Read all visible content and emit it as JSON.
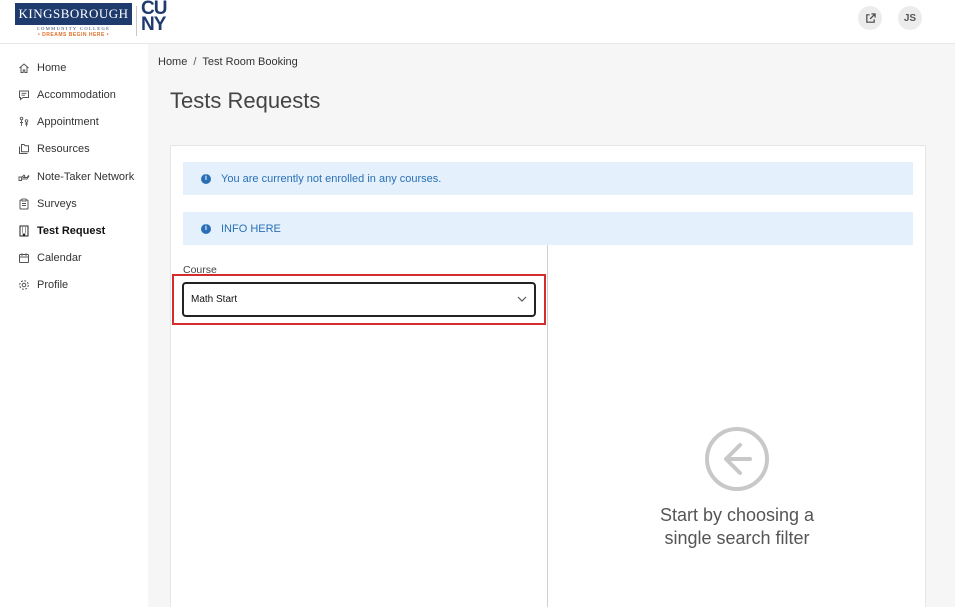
{
  "header": {
    "logo_line1": "KINGSBOROUGH",
    "logo_line2": "COMMUNITY COLLEGE",
    "logo_tagline": "• DREAMS BEGIN HERE •",
    "cuny_top": "CU",
    "cuny_bottom": "NY",
    "external_icon": "external-link-icon",
    "avatar_initials": "JS"
  },
  "sidebar": {
    "items": [
      {
        "label": "Home",
        "icon": "home-icon"
      },
      {
        "label": "Accommodation",
        "icon": "chat-icon"
      },
      {
        "label": "Appointment",
        "icon": "people-icon"
      },
      {
        "label": "Resources",
        "icon": "folders-icon"
      },
      {
        "label": "Note-Taker Network",
        "icon": "hand-icon"
      },
      {
        "label": "Surveys",
        "icon": "clipboard-icon"
      },
      {
        "label": "Test Request",
        "icon": "building-icon",
        "active": true
      },
      {
        "label": "Calendar",
        "icon": "calendar-icon"
      },
      {
        "label": "Profile",
        "icon": "gear-icon"
      }
    ]
  },
  "breadcrumb": {
    "home": "Home",
    "separator": "/",
    "current": "Test Room Booking"
  },
  "page_title": "Tests Requests",
  "alerts": {
    "enrollment": "You are currently not enrolled in any courses.",
    "info": "INFO HERE"
  },
  "course_filter": {
    "label": "Course",
    "selected": "Math Start"
  },
  "empty_state": {
    "line1": "Start by choosing a",
    "line2": "single search filter"
  },
  "colors": {
    "brand_navy": "#1f3b6e",
    "brand_orange": "#e0702a",
    "alert_bg": "#e4f1fc",
    "alert_text": "#2a6fb5",
    "highlight": "#d32d2d"
  }
}
